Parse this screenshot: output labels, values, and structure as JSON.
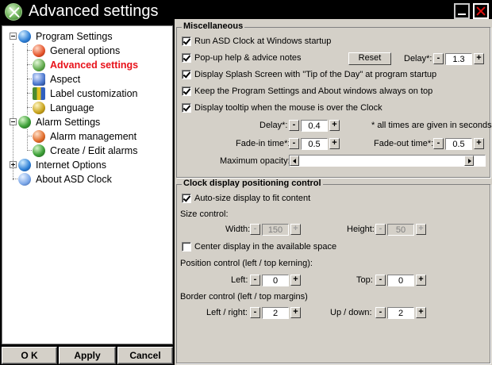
{
  "window": {
    "title": "Advanced settings"
  },
  "tree": {
    "items": [
      {
        "label": "Program Settings",
        "icon": "globe-icon"
      },
      {
        "label": "General options",
        "icon": "gear-icon"
      },
      {
        "label": "Advanced settings",
        "icon": "wrench-icon"
      },
      {
        "label": "Aspect",
        "icon": "aspect-icon"
      },
      {
        "label": "Label customization",
        "icon": "label-icon"
      },
      {
        "label": "Language",
        "icon": "language-icon"
      },
      {
        "label": "Alarm Settings",
        "icon": "alarm-icon"
      },
      {
        "label": "Alarm management",
        "icon": "alarm-management-icon"
      },
      {
        "label": "Create / Edit alarms",
        "icon": "create-alarm-icon"
      },
      {
        "label": "Internet Options",
        "icon": "internet-icon"
      },
      {
        "label": "About ASD Clock",
        "icon": "about-icon"
      }
    ],
    "selected": "Advanced settings"
  },
  "buttons": {
    "ok": "O K",
    "apply": "Apply",
    "cancel": "Cancel"
  },
  "misc": {
    "legend": "Miscellaneous",
    "run_at_startup": "Run ASD Clock at Windows startup",
    "popup_help": "Pop-up help & advice notes",
    "reset": "Reset",
    "delay_label": "Delay*:",
    "popup_delay": "1.3",
    "splash": "Display Splash Screen with \"Tip of the Day\" at program startup",
    "on_top": "Keep the Program Settings and About windows always on top",
    "tooltip": "Display tooltip when the mouse is over the Clock",
    "tooltip_delay": "0.4",
    "note": "* all times are given in seconds",
    "fadein_label": "Fade-in time*:",
    "fadein": "0.5",
    "fadeout_label": "Fade-out time*:",
    "fadeout": "0.5",
    "max_opacity_label": "Maximum opacity:",
    "minus": "-",
    "plus": "+"
  },
  "clock": {
    "legend": "Clock display positioning control",
    "autosize": "Auto-size display to fit content",
    "size_control": "Size control:",
    "width_label": "Width:",
    "width": "150",
    "height_label": "Height:",
    "height": "50",
    "center": "Center display in the available space",
    "position_control": "Position control (left / top kerning):",
    "left_label": "Left:",
    "left": "0",
    "top_label": "Top:",
    "top": "0",
    "border_control": "Border control (left / top margins)",
    "leftright_label": "Left / right:",
    "leftright": "2",
    "updown_label": "Up / down:",
    "updown": "2"
  },
  "checks": {
    "run_at_startup": true,
    "popup_help": true,
    "splash": true,
    "on_top": true,
    "tooltip": true,
    "autosize": true,
    "center": false
  }
}
